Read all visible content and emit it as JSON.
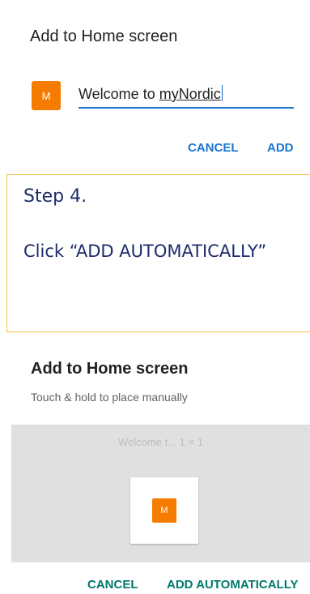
{
  "dialog_top": {
    "title": "Add to Home screen",
    "icon_letter": "M",
    "input_prefix": "Welcome to ",
    "input_misspelled": "myNordic",
    "cancel_label": "CANCEL",
    "add_label": "ADD"
  },
  "step": {
    "heading": "Step 4.",
    "instruction": "Click “ADD AUTOMATICALLY”"
  },
  "dialog_bottom": {
    "title": "Add to Home screen",
    "subtitle": "Touch & hold to place manually",
    "widget_label": "Welcome t...  1 × 1",
    "icon_letter": "M",
    "cancel_label": "CANCEL",
    "add_auto_label": "ADD AUTOMATICALLY"
  },
  "colors": {
    "accent_blue": "#1976d2",
    "accent_teal": "#00796b",
    "app_icon": "#f57c00",
    "callout_border": "#f0c040",
    "callout_text": "#1d2c6b"
  }
}
